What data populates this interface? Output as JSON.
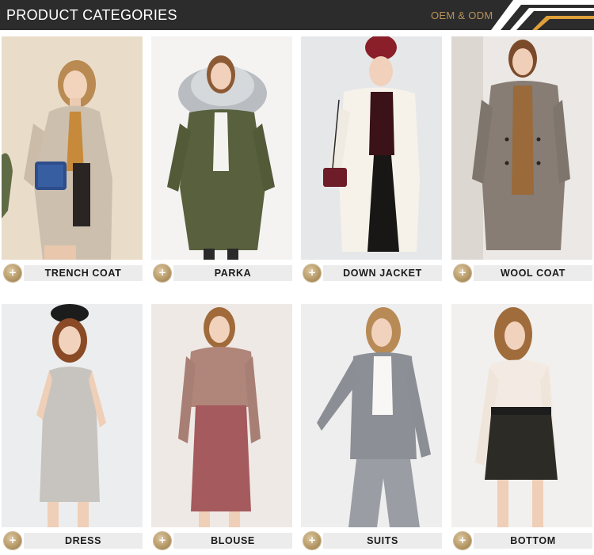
{
  "header": {
    "title": "PRODUCT CATEGORIES",
    "subtitle": "OEM & ODM",
    "background": "#2c2c2c",
    "accent": "#b8935a"
  },
  "badge_symbol": "+",
  "categories": [
    {
      "label": "TRENCH COAT",
      "image": "woman-trench-coat-photo"
    },
    {
      "label": "PARKA",
      "image": "woman-parka-photo"
    },
    {
      "label": "DOWN JACKET",
      "image": "woman-down-jacket-photo"
    },
    {
      "label": "WOOL COAT",
      "image": "woman-wool-coat-photo"
    },
    {
      "label": "DRESS",
      "image": "woman-dress-photo"
    },
    {
      "label": "BLOUSE",
      "image": "woman-blouse-photo"
    },
    {
      "label": "SUITS",
      "image": "woman-suit-photo"
    },
    {
      "label": "BOTTOM",
      "image": "woman-skirt-photo"
    }
  ]
}
